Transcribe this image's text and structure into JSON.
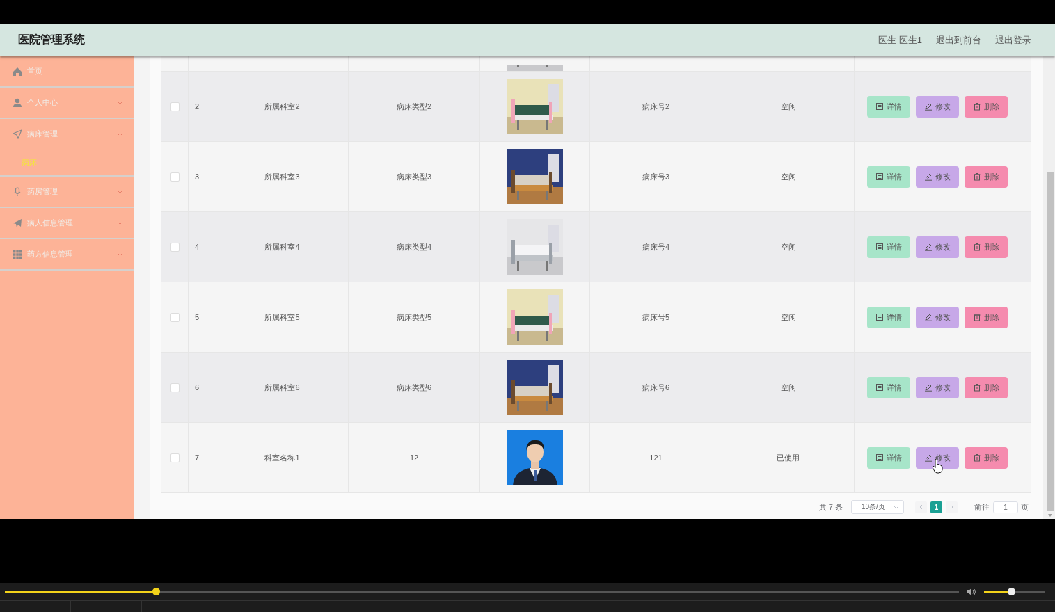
{
  "header": {
    "title": "医院管理系统",
    "user": "医生 医生1",
    "links": [
      "退出到前台",
      "退出登录"
    ]
  },
  "sidebar": {
    "items": [
      {
        "label": "首页",
        "selected": false
      },
      {
        "label": "个人中心",
        "selected": false,
        "expanded": false
      },
      {
        "label": "病床管理",
        "selected": false,
        "expanded": true,
        "children": [
          {
            "label": "病床",
            "selected": true
          }
        ]
      },
      {
        "label": "药房管理",
        "selected": false,
        "expanded": false
      },
      {
        "label": "病人信息管理",
        "selected": false,
        "expanded": false
      },
      {
        "label": "药方信息管理",
        "selected": false,
        "expanded": false
      }
    ]
  },
  "table": {
    "rows": [
      {
        "checked": false,
        "index": "2",
        "department": "所属科室2",
        "bed_type": "病床类型2",
        "image": {
          "kind": "bed"
        },
        "bed_number": "病床号2",
        "status": "空闲",
        "actions": [
          {
            "kind": "detail",
            "label": "详情"
          },
          {
            "kind": "edit",
            "label": "修改"
          },
          {
            "kind": "delete",
            "label": "删除"
          }
        ]
      },
      {
        "checked": false,
        "index": "3",
        "department": "所属科室3",
        "bed_type": "病床类型3",
        "image": {
          "kind": "bed"
        },
        "bed_number": "病床号3",
        "status": "空闲",
        "actions": [
          {
            "kind": "detail",
            "label": "详情"
          },
          {
            "kind": "edit",
            "label": "修改"
          },
          {
            "kind": "delete",
            "label": "删除"
          }
        ]
      },
      {
        "checked": false,
        "index": "4",
        "department": "所属科室4",
        "bed_type": "病床类型4",
        "image": {
          "kind": "bed"
        },
        "bed_number": "病床号4",
        "status": "空闲",
        "actions": [
          {
            "kind": "detail",
            "label": "详情"
          },
          {
            "kind": "edit",
            "label": "修改"
          },
          {
            "kind": "delete",
            "label": "删除"
          }
        ]
      },
      {
        "checked": false,
        "index": "5",
        "department": "所属科室5",
        "bed_type": "病床类型5",
        "image": {
          "kind": "bed"
        },
        "bed_number": "病床号5",
        "status": "空闲",
        "actions": [
          {
            "kind": "detail",
            "label": "详情"
          },
          {
            "kind": "edit",
            "label": "修改"
          },
          {
            "kind": "delete",
            "label": "删除"
          }
        ]
      },
      {
        "checked": false,
        "index": "6",
        "department": "所属科室6",
        "bed_type": "病床类型6",
        "image": {
          "kind": "bed"
        },
        "bed_number": "病床号6",
        "status": "空闲",
        "actions": [
          {
            "kind": "detail",
            "label": "详情"
          },
          {
            "kind": "edit",
            "label": "修改"
          },
          {
            "kind": "delete",
            "label": "删除"
          }
        ]
      },
      {
        "checked": false,
        "index": "7",
        "department": "科室名称1",
        "bed_type": "12",
        "image": {
          "kind": "person"
        },
        "bed_number": "121",
        "status": "已使用",
        "actions": [
          {
            "kind": "detail",
            "label": "详情"
          },
          {
            "kind": "edit",
            "label": "修改"
          },
          {
            "kind": "delete",
            "label": "删除"
          }
        ]
      }
    ]
  },
  "pagination": {
    "total": "共 7 条",
    "page_size": "10条/页",
    "pages": [
      {
        "label": "1",
        "selected": true
      }
    ],
    "goto_label": "前往",
    "goto_value": "1",
    "goto_suffix": "页"
  },
  "player": {
    "progress": {
      "level": 0.158
    },
    "volume": {
      "level": 0.44
    }
  }
}
